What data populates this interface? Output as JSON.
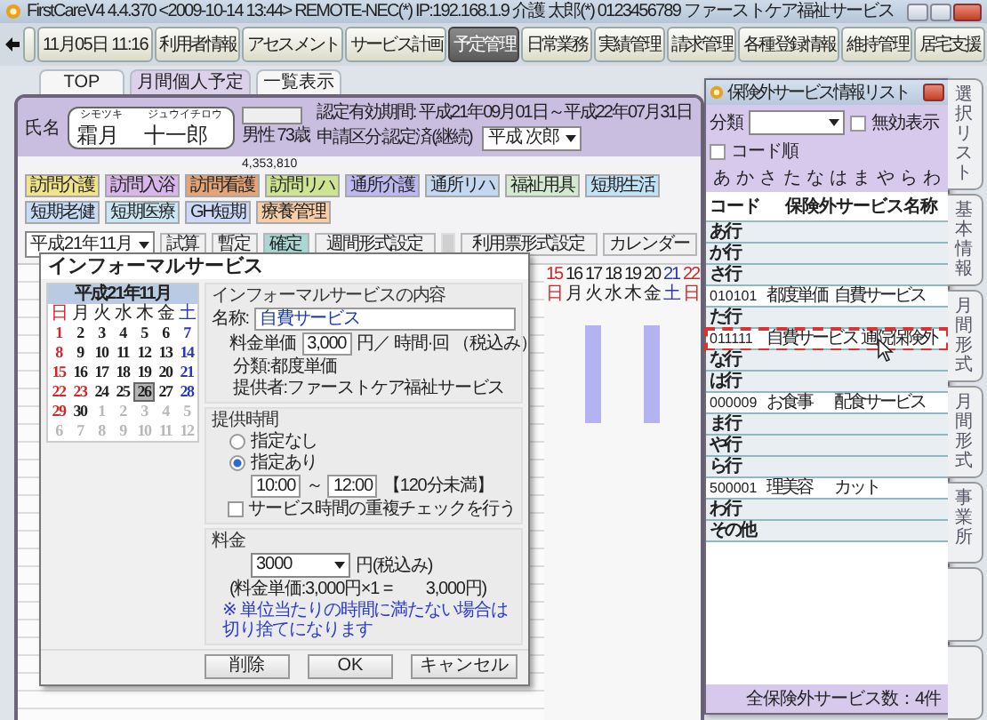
{
  "window": {
    "title": "FirstCareV4 4.4.370 <2009-10-14 13:44> REMOTE-NEC(*) IP:192.168.1.9 介護 太郎(*) 0123456789 ファーストケア福祉サービス"
  },
  "nav": {
    "clock": "11月05日 11:16",
    "items": [
      {
        "label": "利用者情報",
        "selected": false
      },
      {
        "label": "アセスメント",
        "selected": false
      },
      {
        "label": "サービス計画",
        "selected": false
      },
      {
        "label": "予定管理",
        "selected": true
      },
      {
        "label": "日常業務",
        "selected": false
      },
      {
        "label": "実績管理",
        "selected": false
      },
      {
        "label": "請求管理",
        "selected": false
      },
      {
        "label": "各種登録情報",
        "selected": false
      },
      {
        "label": "維持管理",
        "selected": false
      },
      {
        "label": "居宅支援",
        "selected": false
      }
    ]
  },
  "subtabs": [
    {
      "label": "TOP",
      "selected": false
    },
    {
      "label": "月間個人予定",
      "selected": true
    },
    {
      "label": "一覧表示",
      "selected": false
    }
  ],
  "client": {
    "name_label": "氏名",
    "kana_family": "シモツキ",
    "family": "霜月",
    "kana_given": "ジュウイチロウ",
    "given": "十一郎",
    "sex_age": "男性 73歳",
    "period": "認定有効期間: 平成21年09月01日～平成22年07月31日",
    "application": "申請区分:認定済(継続)",
    "manager": "平成 次郎",
    "amount": "4,353,810"
  },
  "services": [
    {
      "label": "訪問介護",
      "color": "#f0e38a"
    },
    {
      "label": "訪問入浴",
      "color": "#d9b6ea"
    },
    {
      "label": "訪問看護",
      "color": "#e3a578"
    },
    {
      "label": "訪問リハ",
      "color": "#cfe493"
    },
    {
      "label": "通所介護",
      "color": "#bdb9f0"
    },
    {
      "label": "通所リハ",
      "color": "#c3d8f0"
    },
    {
      "label": "福祉用具",
      "color": "#d3ead0"
    },
    {
      "label": "短期生活",
      "color": "#c2e2f6"
    },
    {
      "label": "短期老健",
      "color": "#c6dcf4"
    },
    {
      "label": "短期医療",
      "color": "#cae6f2"
    },
    {
      "label": "GH短期",
      "color": "#cbd9f6"
    },
    {
      "label": "療養管理",
      "color": "#f6cda6"
    }
  ],
  "toolbar": {
    "month": "平成21年11月",
    "modes": [
      {
        "label": "試算",
        "selected": false
      },
      {
        "label": "暫定",
        "selected": false
      },
      {
        "label": "確定",
        "selected": true
      }
    ],
    "buttons": [
      "週間形式設定",
      "利用票形式設定",
      "カレンダー"
    ]
  },
  "calendar": {
    "days": [
      {
        "day": "15",
        "weekday": "日",
        "kind": "sun",
        "booked": false
      },
      {
        "day": "16",
        "weekday": "月",
        "kind": "day",
        "booked": false
      },
      {
        "day": "17",
        "weekday": "火",
        "kind": "day",
        "booked": true
      },
      {
        "day": "18",
        "weekday": "水",
        "kind": "day",
        "booked": false
      },
      {
        "day": "19",
        "weekday": "木",
        "kind": "day",
        "booked": false
      },
      {
        "day": "20",
        "weekday": "金",
        "kind": "day",
        "booked": true
      },
      {
        "day": "21",
        "weekday": "土",
        "kind": "sat",
        "booked": false
      },
      {
        "day": "22",
        "weekday": "日",
        "kind": "sun",
        "booked": false
      }
    ]
  },
  "dialog": {
    "title": "インフォーマルサービス",
    "mini_calendar": {
      "title": "平成21年11月",
      "weekdays": [
        {
          "label": "日",
          "kind": "sun"
        },
        {
          "label": "月",
          "kind": "day"
        },
        {
          "label": "火",
          "kind": "day"
        },
        {
          "label": "水",
          "kind": "day"
        },
        {
          "label": "木",
          "kind": "day"
        },
        {
          "label": "金",
          "kind": "day"
        },
        {
          "label": "土",
          "kind": "sat"
        }
      ],
      "days": [
        {
          "label": "1",
          "kind": "sun",
          "selected": false
        },
        {
          "label": "2",
          "kind": "day",
          "selected": false
        },
        {
          "label": "3",
          "kind": "day",
          "selected": false
        },
        {
          "label": "4",
          "kind": "day",
          "selected": false
        },
        {
          "label": "5",
          "kind": "day",
          "selected": false
        },
        {
          "label": "6",
          "kind": "day",
          "selected": false
        },
        {
          "label": "7",
          "kind": "sat",
          "selected": false
        },
        {
          "label": "8",
          "kind": "sun",
          "selected": false
        },
        {
          "label": "9",
          "kind": "day",
          "selected": false
        },
        {
          "label": "10",
          "kind": "day",
          "selected": false
        },
        {
          "label": "11",
          "kind": "day",
          "selected": false
        },
        {
          "label": "12",
          "kind": "day",
          "selected": false
        },
        {
          "label": "13",
          "kind": "day",
          "selected": false
        },
        {
          "label": "14",
          "kind": "sat",
          "selected": false
        },
        {
          "label": "15",
          "kind": "sun",
          "selected": false
        },
        {
          "label": "16",
          "kind": "day",
          "selected": false
        },
        {
          "label": "17",
          "kind": "day",
          "selected": false
        },
        {
          "label": "18",
          "kind": "day",
          "selected": false
        },
        {
          "label": "19",
          "kind": "day",
          "selected": false
        },
        {
          "label": "20",
          "kind": "day",
          "selected": false
        },
        {
          "label": "21",
          "kind": "sat",
          "selected": false
        },
        {
          "label": "22",
          "kind": "sun",
          "selected": false
        },
        {
          "label": "23",
          "kind": "sun",
          "selected": false
        },
        {
          "label": "24",
          "kind": "day",
          "selected": false
        },
        {
          "label": "25",
          "kind": "day",
          "selected": false
        },
        {
          "label": "26",
          "kind": "day",
          "selected": true
        },
        {
          "label": "27",
          "kind": "day",
          "selected": false
        },
        {
          "label": "28",
          "kind": "sat",
          "selected": false
        },
        {
          "label": "29",
          "kind": "sun",
          "selected": false
        },
        {
          "label": "30",
          "kind": "day",
          "selected": false
        },
        {
          "label": "1",
          "kind": "other",
          "selected": false
        },
        {
          "label": "2",
          "kind": "other",
          "selected": false
        },
        {
          "label": "3",
          "kind": "other",
          "selected": false
        },
        {
          "label": "4",
          "kind": "other",
          "selected": false
        },
        {
          "label": "5",
          "kind": "other",
          "selected": false
        },
        {
          "label": "6",
          "kind": "other",
          "selected": false
        },
        {
          "label": "7",
          "kind": "other",
          "selected": false
        },
        {
          "label": "8",
          "kind": "other",
          "selected": false
        },
        {
          "label": "9",
          "kind": "other",
          "selected": false
        },
        {
          "label": "10",
          "kind": "other",
          "selected": false
        },
        {
          "label": "11",
          "kind": "other",
          "selected": false
        },
        {
          "label": "12",
          "kind": "other",
          "selected": false
        }
      ]
    },
    "content_legend": "インフォーマルサービスの内容",
    "name_label": "名称:",
    "name_value": "自費サービス",
    "price_label": "料金単価",
    "price_value": "3,000",
    "price_unit": "円／ 時間·回 （税込み）",
    "category": "分類:都度単価",
    "provider": "提供者:ファーストケア福祉サービス",
    "time_legend": "提供時間",
    "time_options": [
      {
        "label": "指定なし",
        "selected": false
      },
      {
        "label": "指定あり",
        "selected": true
      }
    ],
    "time_from": "10:00",
    "time_sep": "～",
    "time_to": "12:00",
    "time_note": "【120分未満】",
    "overlap_check": {
      "label": "サービス時間の重複チェックを行う",
      "checked": false
    },
    "fee_legend": "料金",
    "fee_value": "3000",
    "fee_unit": "円(税込み)",
    "fee_calc": "(料金単価:3,000円×1 =　　3,000円)",
    "fee_note": "※ 単位当たりの時間に満たない場合は切り捨てになります",
    "buttons": [
      "削除",
      "OK",
      "キャンセル"
    ]
  },
  "panel": {
    "title": "保険外サービス情報リスト",
    "category_label": "分類",
    "show_invalid": {
      "label": "無効表示",
      "checked": false
    },
    "code_order": {
      "label": "コード順",
      "checked": false
    },
    "kana": [
      "あ",
      "か",
      "さ",
      "た",
      "な",
      "は",
      "ま",
      "や",
      "ら",
      "わ"
    ],
    "columns": [
      "コード",
      "保険外サービス名称"
    ],
    "rows": [
      {
        "kind": "group",
        "label": "あ行",
        "selected": false
      },
      {
        "kind": "group",
        "label": "か行",
        "selected": false
      },
      {
        "kind": "group",
        "label": "さ行",
        "selected": false
      },
      {
        "kind": "item",
        "code": "010101",
        "category": "都度単価",
        "name": "自費サービス",
        "selected": false
      },
      {
        "kind": "group",
        "label": "た行",
        "selected": false
      },
      {
        "kind": "item",
        "code": "011111",
        "category": "自費サービス",
        "name": "通院保険外",
        "selected": true
      },
      {
        "kind": "group",
        "label": "な行",
        "selected": false
      },
      {
        "kind": "group",
        "label": "は行",
        "selected": false
      },
      {
        "kind": "item",
        "code": "000009",
        "category": "お食事",
        "name": "配食サービス",
        "selected": false
      },
      {
        "kind": "group",
        "label": "ま行",
        "selected": false
      },
      {
        "kind": "group",
        "label": "や行",
        "selected": false
      },
      {
        "kind": "group",
        "label": "ら行",
        "selected": false
      },
      {
        "kind": "item",
        "code": "500001",
        "category": "理美容",
        "name": "カット",
        "selected": false
      },
      {
        "kind": "group",
        "label": "わ行",
        "selected": false
      },
      {
        "kind": "group",
        "label": "その他",
        "selected": false
      }
    ],
    "footer": "全保険外サービス数：4件"
  },
  "side_tabs": [
    "選択リスト",
    "基本情報",
    "月間形式",
    "月間形式",
    "事業所"
  ]
}
